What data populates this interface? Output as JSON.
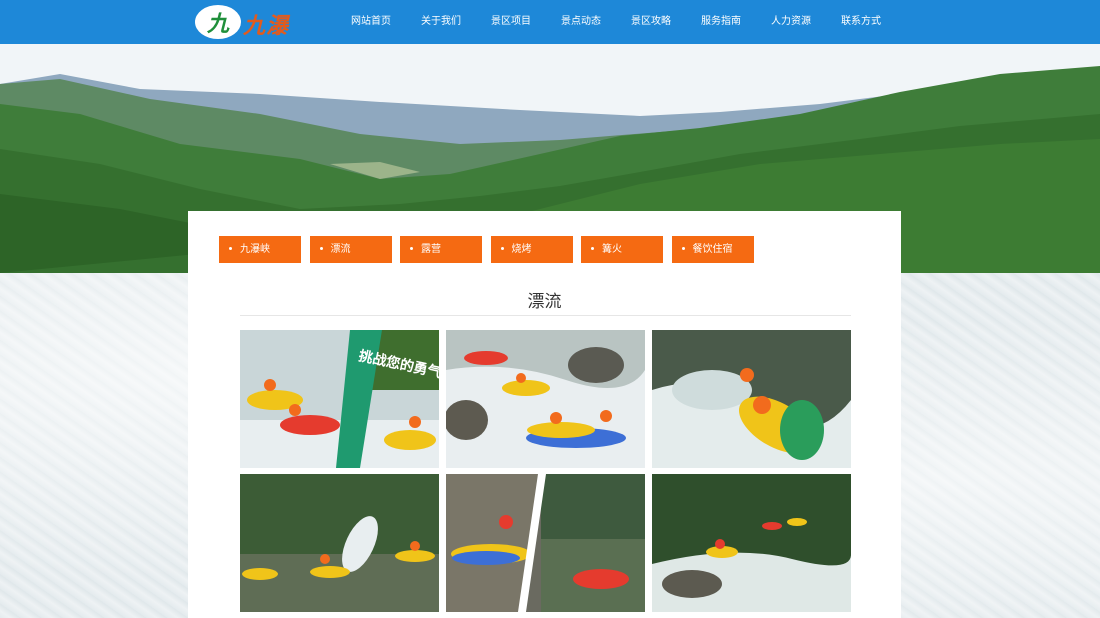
{
  "logo": {
    "mark": "九",
    "name": "九瀑峡"
  },
  "nav": [
    "网站首页",
    "关于我们",
    "景区项目",
    "景点动态",
    "景区攻略",
    "服务指南",
    "人力资源",
    "联系方式"
  ],
  "categories": [
    "九瀑峡",
    "漂流",
    "露营",
    "烧烤",
    "篝火",
    "餐饮住宿"
  ],
  "section_title": "漂流",
  "photos": [
    {
      "name": "rafting-photo-1",
      "overlay_text": "挑战您的勇气与胆略"
    },
    {
      "name": "rafting-photo-2"
    },
    {
      "name": "rafting-photo-3"
    },
    {
      "name": "rafting-photo-4"
    },
    {
      "name": "rafting-photo-5"
    },
    {
      "name": "rafting-photo-6"
    }
  ],
  "colors": {
    "header": "#1e88d8",
    "category": "#f56a12",
    "logo_text": "#e25b1d",
    "logo_green": "#1f8f3a"
  }
}
